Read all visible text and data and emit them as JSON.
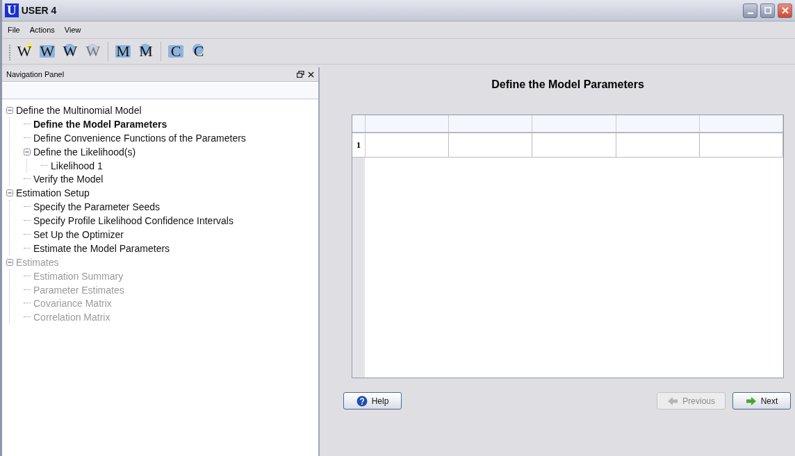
{
  "window": {
    "logo": "U",
    "title": "USER 4"
  },
  "menu": [
    "File",
    "Actions",
    "View"
  ],
  "toolbar": {
    "groups": [
      {
        "buttons": [
          {
            "letter": "W",
            "kind": "new",
            "disabled": false
          },
          {
            "letter": "W",
            "kind": "open",
            "disabled": false
          },
          {
            "letter": "W",
            "kind": "save",
            "disabled": false
          },
          {
            "letter": "W",
            "kind": "save",
            "disabled": true
          }
        ]
      },
      {
        "buttons": [
          {
            "letter": "M",
            "kind": "open",
            "disabled": false
          },
          {
            "letter": "M",
            "kind": "save",
            "disabled": false
          }
        ]
      },
      {
        "buttons": [
          {
            "letter": "C",
            "kind": "open",
            "disabled": false
          },
          {
            "letter": "C",
            "kind": "save",
            "disabled": false
          }
        ]
      }
    ]
  },
  "navigation_panel": {
    "title": "Navigation Panel",
    "tree": [
      {
        "label": "Define the Multinomial Model",
        "expanded": true,
        "selected": false,
        "disabled": false,
        "children": [
          {
            "label": "Define the Model Parameters",
            "selected": true,
            "disabled": false
          },
          {
            "label": "Define Convenience Functions of the Parameters",
            "selected": false,
            "disabled": false
          },
          {
            "label": "Define the Likelihood(s)",
            "expanded": true,
            "selected": false,
            "disabled": false,
            "children": [
              {
                "label": "Likelihood 1",
                "selected": false,
                "disabled": false
              }
            ]
          },
          {
            "label": "Verify the Model",
            "selected": false,
            "disabled": false
          }
        ]
      },
      {
        "label": "Estimation Setup",
        "expanded": true,
        "selected": false,
        "disabled": false,
        "children": [
          {
            "label": "Specify the Parameter Seeds",
            "selected": false,
            "disabled": false
          },
          {
            "label": "Specify Profile Likelihood Confidence Intervals",
            "selected": false,
            "disabled": false
          },
          {
            "label": "Set Up the Optimizer",
            "selected": false,
            "disabled": false
          },
          {
            "label": "Estimate the Model Parameters",
            "selected": false,
            "disabled": false
          }
        ]
      },
      {
        "label": "Estimates",
        "expanded": true,
        "selected": false,
        "disabled": true,
        "children": [
          {
            "label": "Estimation Summary",
            "selected": false,
            "disabled": true
          },
          {
            "label": "Parameter Estimates",
            "selected": false,
            "disabled": true
          },
          {
            "label": "Covariance Matrix",
            "selected": false,
            "disabled": true
          },
          {
            "label": "Correlation Matrix",
            "selected": false,
            "disabled": true
          }
        ]
      }
    ]
  },
  "content": {
    "heading": "Define the Model Parameters",
    "table": {
      "rows": [
        {
          "number": "1"
        }
      ]
    },
    "buttons": [
      {
        "label": "Help",
        "kind": "help",
        "disabled": false
      },
      {
        "label": "Previous",
        "kind": "previous",
        "disabled": true
      },
      {
        "label": "Next",
        "kind": "next",
        "disabled": false
      }
    ]
  }
}
